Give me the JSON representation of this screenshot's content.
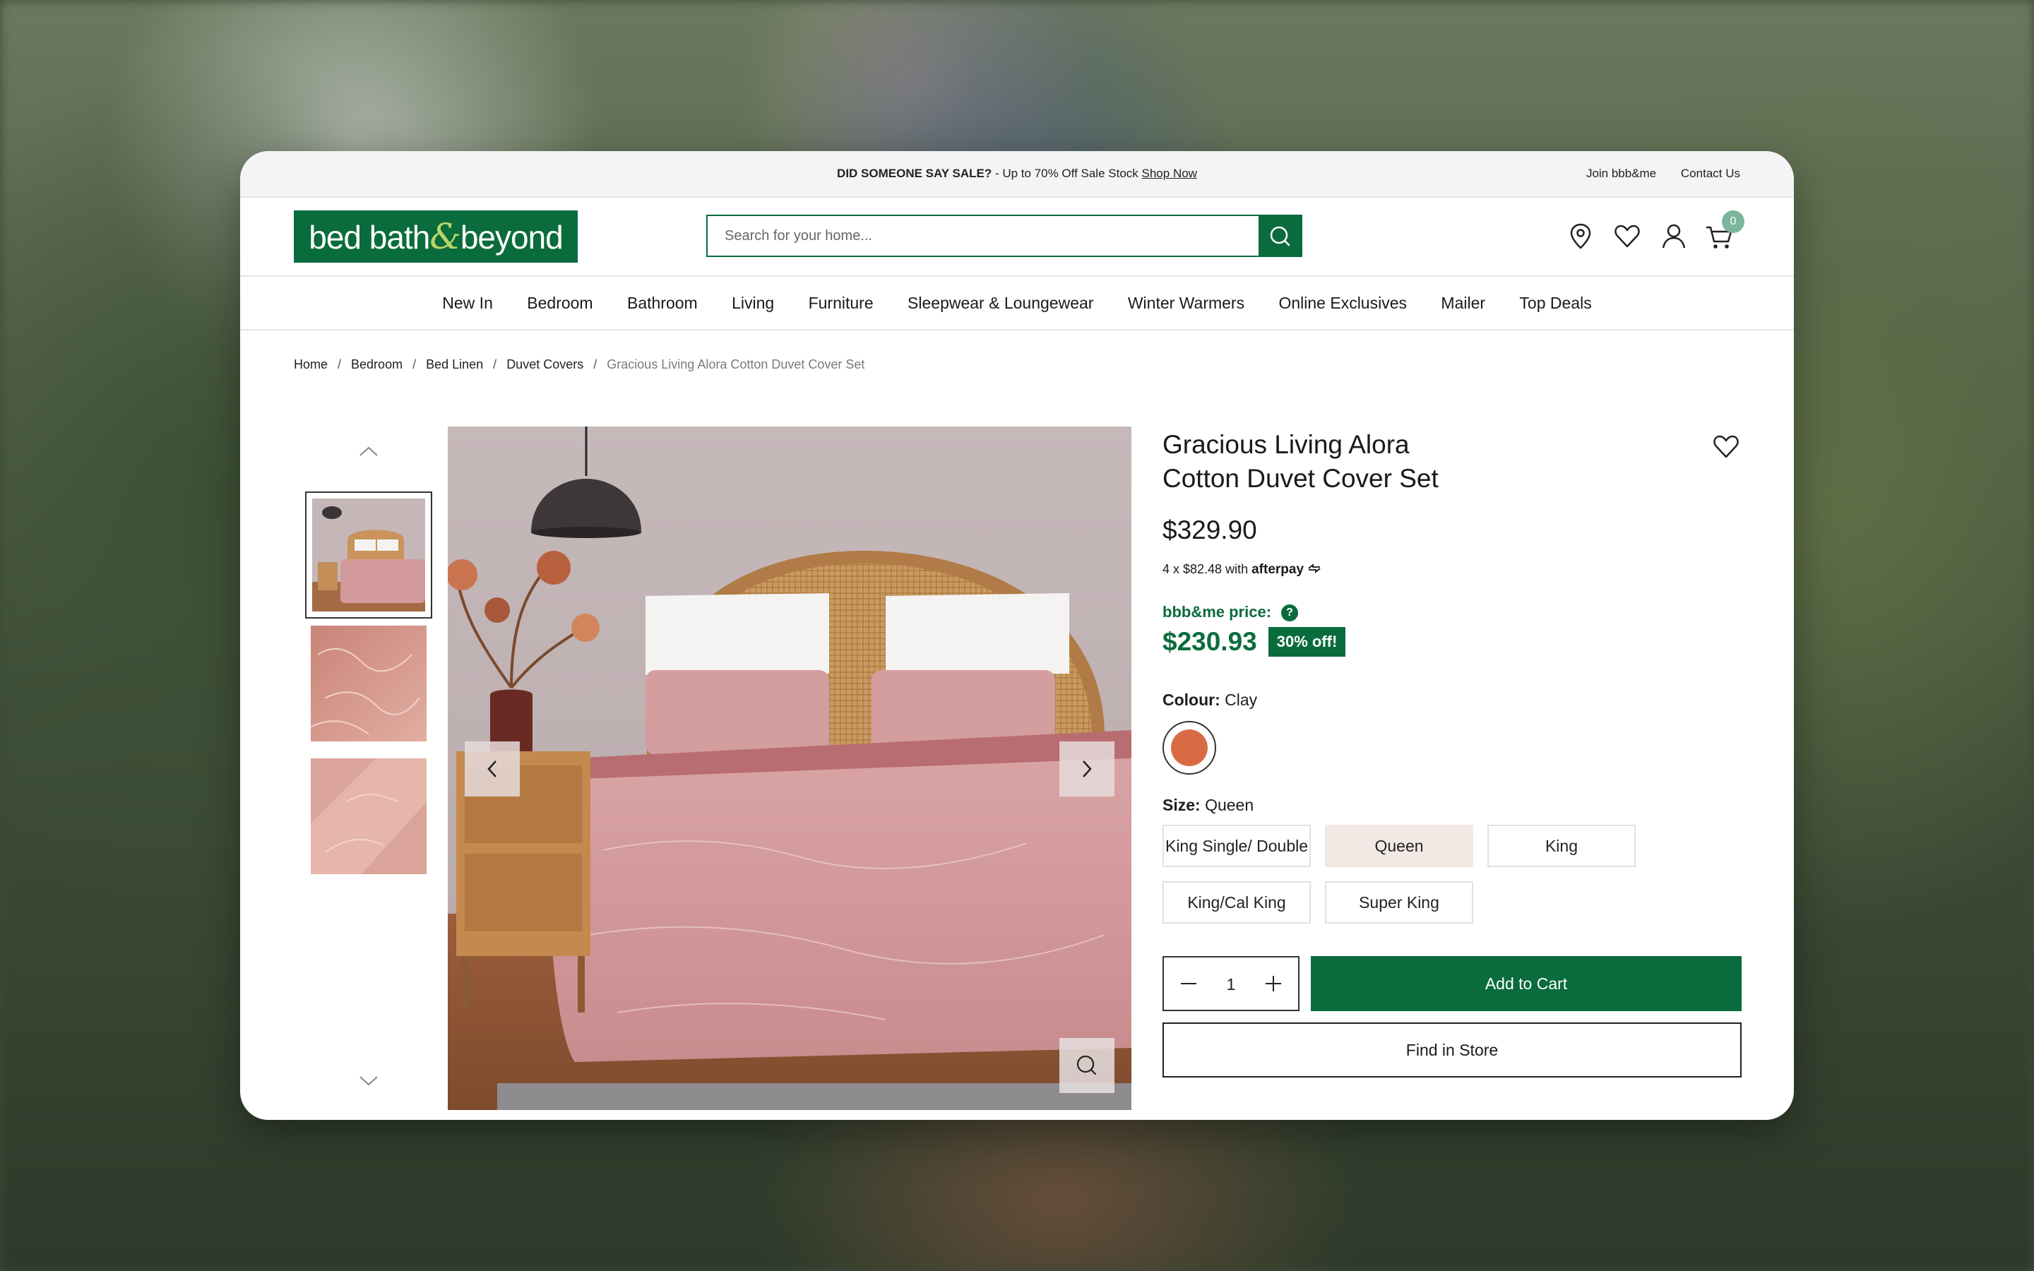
{
  "promo": {
    "headline": "DID SOMEONE SAY SALE?",
    "text": " - Up to 70% Off Sale Stock ",
    "link": "Shop Now",
    "links": [
      "Join bbb&me",
      "Contact Us"
    ]
  },
  "brand": {
    "logo_left": "bed bath",
    "logo_amp": "&",
    "logo_right": "beyond"
  },
  "search": {
    "placeholder": "Search for your home..."
  },
  "header": {
    "cart_count": "0"
  },
  "nav": [
    "New In",
    "Bedroom",
    "Bathroom",
    "Living",
    "Furniture",
    "Sleepwear & Loungewear",
    "Winter Warmers",
    "Online Exclusives",
    "Mailer",
    "Top Deals"
  ],
  "breadcrumb": [
    "Home",
    "Bedroom",
    "Bed Linen",
    "Duvet Covers",
    "Gracious Living Alora Cotton Duvet Cover Set"
  ],
  "product": {
    "title_line1": "Gracious Living Alora",
    "title_line2": "Cotton Duvet Cover Set",
    "price": "$329.90",
    "afterpay_text": "4 x $82.48 with",
    "afterpay_brand": "afterpay",
    "member_label": "bbb&me price:",
    "member_help": "?",
    "member_price": "$230.93",
    "discount": "30% off!",
    "colour_label": "Colour:",
    "colour_value": "Clay",
    "colour_swatch": "#d96b44",
    "size_label": "Size:",
    "size_value": "Queen",
    "sizes": [
      "King Single/ Double",
      "Queen",
      "King",
      "King/Cal King",
      "Super King"
    ],
    "selected_size": "Queen",
    "quantity": "1",
    "add_to_cart": "Add to Cart",
    "find_in_store": "Find in Store"
  },
  "colors": {
    "brand_green": "#0a6c3c",
    "badge": "#7bb59b",
    "clay": "#d96b44"
  }
}
